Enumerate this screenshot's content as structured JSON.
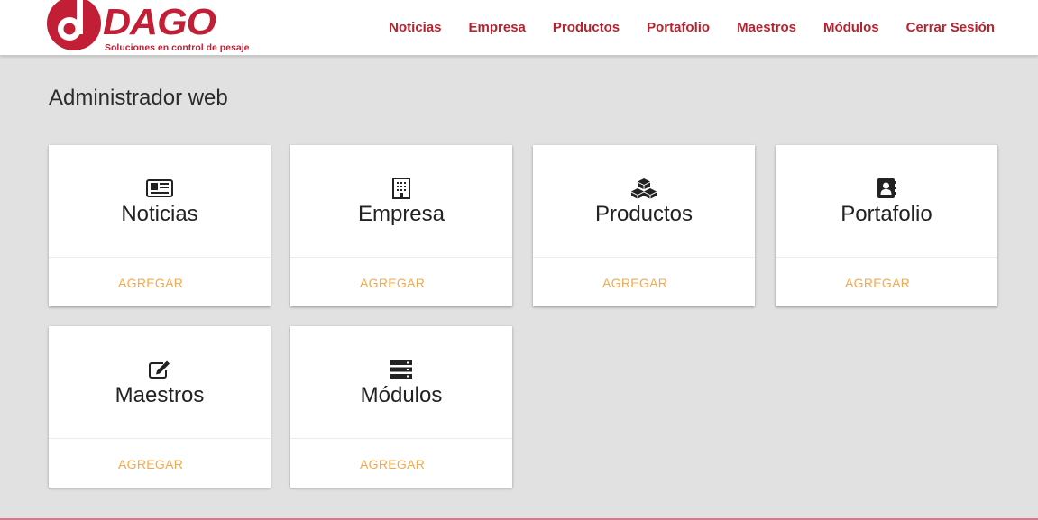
{
  "brand": {
    "name": "DAGO",
    "tagline": "Soluciones en control de pesaje",
    "color": "#c21e35"
  },
  "nav": {
    "items": [
      {
        "label": "Noticias"
      },
      {
        "label": "Empresa"
      },
      {
        "label": "Productos"
      },
      {
        "label": "Portafolio"
      },
      {
        "label": "Maestros"
      },
      {
        "label": "Módulos"
      },
      {
        "label": "Cerrar Sesión"
      }
    ]
  },
  "page": {
    "title": "Administrador web"
  },
  "cards": [
    {
      "title": "Noticias",
      "icon": "newspaper-icon",
      "action": "AGREGAR"
    },
    {
      "title": "Empresa",
      "icon": "building-icon",
      "action": "AGREGAR"
    },
    {
      "title": "Productos",
      "icon": "cubes-icon",
      "action": "AGREGAR"
    },
    {
      "title": "Portafolio",
      "icon": "address-book-icon",
      "action": "AGREGAR"
    },
    {
      "title": "Maestros",
      "icon": "edit-icon",
      "action": "AGREGAR"
    },
    {
      "title": "Módulos",
      "icon": "server-icon",
      "action": "AGREGAR"
    }
  ],
  "colors": {
    "nav_text": "#b8222e",
    "action_text": "#f3a94d",
    "background": "#e1e1e1"
  }
}
